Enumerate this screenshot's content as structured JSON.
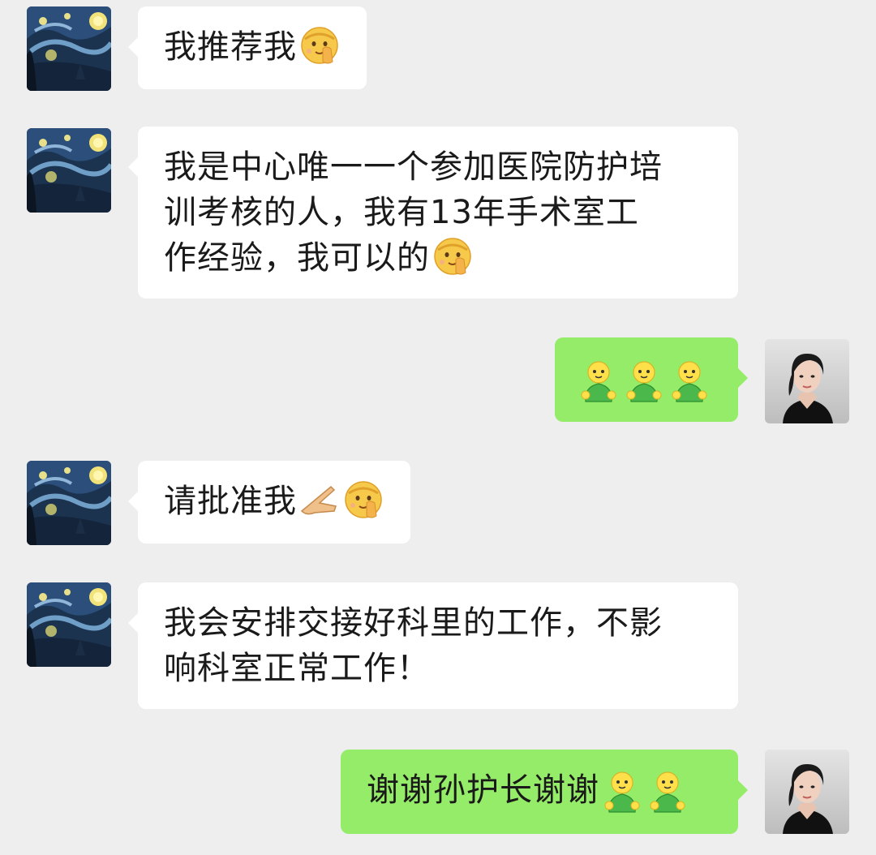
{
  "chat": {
    "messages": [
      {
        "side": "in",
        "text": "我推荐我",
        "emoji": [
          "shushing-face-emoji"
        ]
      },
      {
        "side": "in",
        "text_lines": [
          "我是中心唯一一个参加医院防护培",
          "训考核的人，我有13年手术室工",
          "作经验，我可以的"
        ],
        "emoji": [
          "shushing-face-emoji"
        ]
      },
      {
        "side": "out",
        "text": "",
        "emoji": [
          "little-green-guy-icon",
          "little-green-guy-icon",
          "little-green-guy-icon"
        ]
      },
      {
        "side": "in",
        "text": "请批准我",
        "emoji": [
          "pointing-hand-emoji",
          "shushing-face-emoji"
        ]
      },
      {
        "side": "in",
        "text_lines": [
          "我会安排交接好科里的工作，不影",
          "响科室正常工作！"
        ]
      },
      {
        "side": "out",
        "text": "谢谢孙护长谢谢",
        "emoji": [
          "little-green-guy-icon",
          "little-green-guy-icon"
        ]
      }
    ]
  },
  "avatars": {
    "left": "starry-night-avatar",
    "right": "woman-portrait-avatar"
  },
  "colors": {
    "background": "#eeeeee",
    "incoming_bubble": "#ffffff",
    "outgoing_bubble": "#95ec69"
  }
}
